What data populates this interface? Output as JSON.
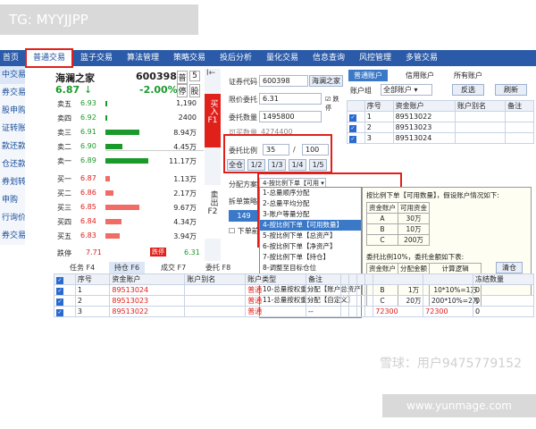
{
  "overlay_tag": "TG: MYYJJPP",
  "footer_url": "www.yunmage.com",
  "watermark": "雪球：用户9475779152",
  "menu": [
    "首页",
    "普通交易",
    "篮子交易",
    "算法管理",
    "策略交易",
    "投后分析",
    "量化交易",
    "信息查询",
    "风控管理",
    "多管交易"
  ],
  "left_nav": [
    "中交易",
    "券交易",
    "股申购",
    "证转账",
    "款还款",
    "仓还款",
    "券划转",
    "申购",
    "行询价",
    "券交易"
  ],
  "stock": {
    "name": "海澜之家",
    "code": "600398",
    "price": "6.87",
    "arrow": "↓",
    "change": "-2.00%",
    "btn_pu": "普",
    "btn_5": "5",
    "btn_ting": "停",
    "btn_fu": "股"
  },
  "sell_levels": [
    {
      "label": "卖五",
      "price": "6.93",
      "vol": "1,190",
      "bar": 0.05
    },
    {
      "label": "卖四",
      "price": "6.92",
      "vol": "2400",
      "bar": 0.0
    },
    {
      "label": "卖三",
      "price": "6.91",
      "vol": "8.94万",
      "bar": 0.8
    },
    {
      "label": "卖二",
      "price": "6.90",
      "vol": "4.45万",
      "bar": 0.4
    },
    {
      "label": "卖一",
      "price": "6.89",
      "vol": "11.17万",
      "bar": 1.0
    }
  ],
  "buy_levels": [
    {
      "label": "买一",
      "price": "6.87",
      "vol": "1.13万",
      "bar": 0.1
    },
    {
      "label": "买二",
      "price": "6.86",
      "vol": "2.17万",
      "bar": 0.18
    },
    {
      "label": "买三",
      "price": "6.85",
      "vol": "9.67万",
      "bar": 0.8
    },
    {
      "label": "买四",
      "price": "6.84",
      "vol": "4.34万",
      "bar": 0.38
    },
    {
      "label": "买五",
      "price": "6.83",
      "vol": "3.94万",
      "bar": 0.34
    }
  ],
  "limit_down_label": "跌停",
  "limit_down_value": "7.71",
  "limit_down_btn": "跌停",
  "limit_up_value": "6.31",
  "side_buttons": {
    "buy": "买入",
    "buy_key": "F1",
    "sell": "卖出",
    "sell_key": "F2"
  },
  "form": {
    "code_label": "证券代码",
    "code_value": "600398",
    "code_name": "海澜之家",
    "price_label": "限价委托",
    "price_value": "6.31",
    "price_cb": "跌停",
    "qty_label": "委托数量",
    "qty_value": "1495800",
    "avail_label": "可买数量",
    "avail_value": "4274400",
    "ratio_label": "委托比例",
    "ratio_num": "35",
    "ratio_sep": "/",
    "ratio_den": "100",
    "ratio_btns": [
      "全仓",
      "1/2",
      "1/3",
      "1/4",
      "1/5"
    ],
    "alloc_label": "分配方案",
    "alloc_value": "4-按比例下单【可用",
    "split_label": "拆单策略",
    "order_btn_partial": "149",
    "chk_label": "下单前"
  },
  "dropdown": [
    "1-总量顺序分配",
    "2-总量平均分配",
    "3-账户等量分配",
    "4-按比例下单【可用数量】",
    "5-按比例下单【总资产】",
    "6-按比例下单【净资产】",
    "7-按比例下单【持仓】",
    "8-调整至目标仓位",
    "9-总量按权重分配【账户可用】",
    "10-总量按权重分配【账户总资产】",
    "11-总量按权重分配【自定义】"
  ],
  "tip": {
    "h1": "按比例下单【可用数量】，假设账户情况如下:",
    "t1_head": [
      "资金账户",
      "可用资金"
    ],
    "t1_rows": [
      [
        "A",
        "30万"
      ],
      [
        "B",
        "10万"
      ],
      [
        "C",
        "200万"
      ]
    ],
    "h2": "委托比例10%，委托金额如下表:",
    "t2_head": [
      "资金账户",
      "分配金额",
      "计算逻辑"
    ],
    "t2_rows": [
      [
        "A",
        "3万",
        "30*10%=3万"
      ],
      [
        "B",
        "1万",
        "10*10%=1万"
      ],
      [
        "C",
        "20万",
        "200*10%=2万"
      ]
    ]
  },
  "account_tabs": [
    "普通账户",
    "信用账户",
    "所有账户"
  ],
  "group_label": "账户组",
  "group_value": "全部账户",
  "btn_invert": "反选",
  "btn_refresh": "刷新",
  "acct_head": [
    "序号",
    "资金账户",
    "账户别名",
    "备注"
  ],
  "acct_rows": [
    [
      "1",
      "89513022",
      "",
      ""
    ],
    [
      "2",
      "89513023",
      "",
      ""
    ],
    [
      "3",
      "89513024",
      "",
      ""
    ]
  ],
  "bottom_tabs": [
    "任务 F4",
    "持仓 F6",
    "成交 F7",
    "委托 F8"
  ],
  "btn_clear": "清仓",
  "orders_head": [
    "序号",
    "资金账户",
    "账户别名",
    "账户类型",
    "备注",
    "",
    "",
    "",
    "",
    "",
    "",
    "冻结数量"
  ],
  "orders_rows": [
    [
      "1",
      "89513024",
      "",
      "普通",
      "--",
      "",
      "",
      "",
      "",
      "",
      "",
      "0"
    ],
    [
      "2",
      "89513023",
      "",
      "普通",
      "--",
      "",
      "",
      "",
      "",
      "",
      "",
      "0"
    ],
    [
      "3",
      "89513022",
      "",
      "普通",
      "--",
      "",
      "",
      "",
      "",
      "72300",
      "72300",
      "0"
    ]
  ],
  "colors": {
    "menu_bg": "#2a5aa8",
    "buy_red": "#e0201b",
    "sell_green": "#1a9a2a",
    "highlight": "#e0201b"
  }
}
